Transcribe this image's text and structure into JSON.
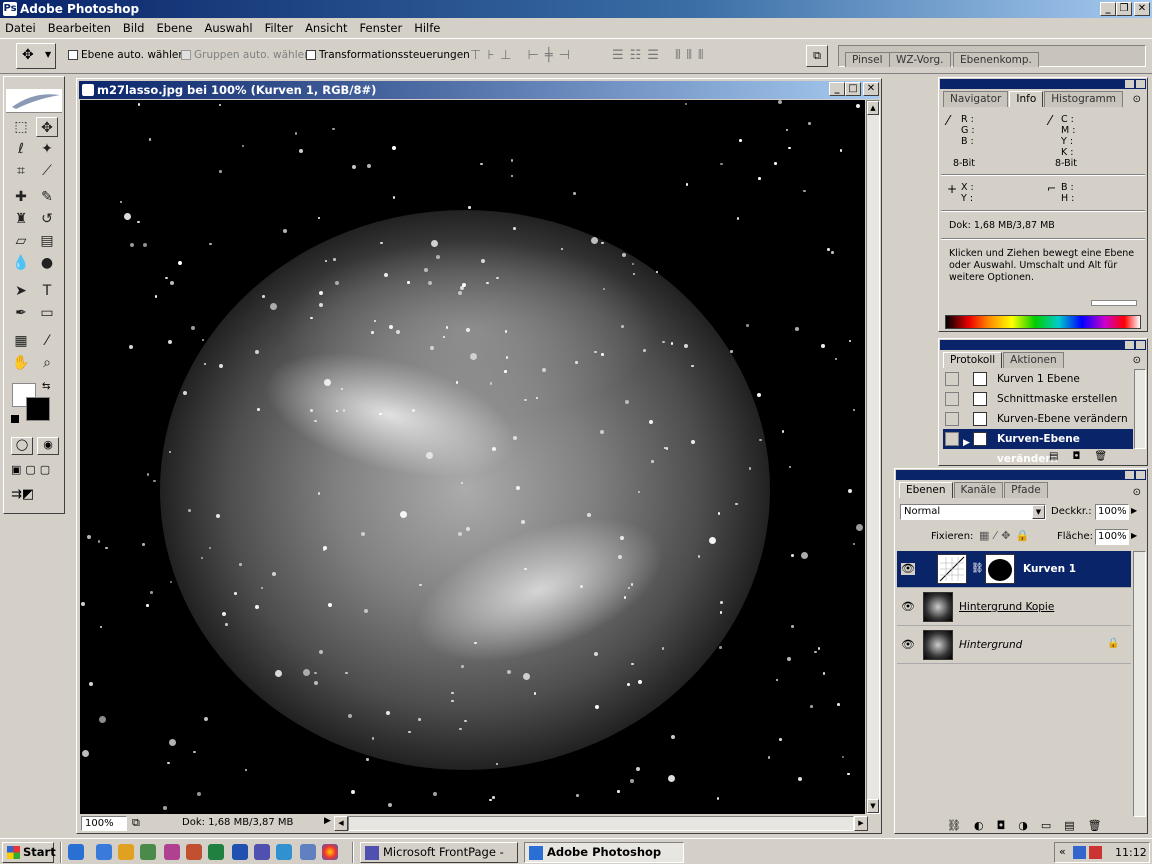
{
  "app": {
    "title": "Adobe Photoshop"
  },
  "menu": [
    "Datei",
    "Bearbeiten",
    "Bild",
    "Ebene",
    "Auswahl",
    "Filter",
    "Ansicht",
    "Fenster",
    "Hilfe"
  ],
  "options": {
    "auto_select_layer": "Ebene auto. wählen",
    "auto_select_groups": "Gruppen auto. wählen",
    "transform_controls": "Transformationssteuerungen",
    "palette_well": [
      "Pinsel",
      "WZ-Vorg.",
      "Ebenenkomp."
    ]
  },
  "document": {
    "title": "m27lasso.jpg bei 100% (Kurven 1, RGB/8#)",
    "zoom": "100%",
    "status": "Dok: 1,68 MB/3,87 MB"
  },
  "info_panel": {
    "tabs": [
      "Navigator",
      "Info",
      "Histogramm"
    ],
    "rgb_labels": [
      "R :",
      "G :",
      "B :"
    ],
    "cmyk_labels": [
      "C :",
      "M :",
      "Y :",
      "K :"
    ],
    "bitdepth_left": "8-Bit",
    "bitdepth_right": "8-Bit",
    "xy_labels": [
      "X :",
      "Y :"
    ],
    "bh_labels": [
      "B :",
      "H :"
    ],
    "doc_size": "Dok: 1,68 MB/3,87 MB",
    "hint": "Klicken und Ziehen bewegt eine Ebene oder Auswahl. Umschalt und Alt für weitere Optionen."
  },
  "history_panel": {
    "tabs": [
      "Protokoll",
      "Aktionen"
    ],
    "items": [
      "Kurven 1 Ebene",
      "Schnittmaske erstellen",
      "Kurven-Ebene verändern",
      "Kurven-Ebene verändern"
    ]
  },
  "layers_panel": {
    "tabs": [
      "Ebenen",
      "Kanäle",
      "Pfade"
    ],
    "blend_mode": "Normal",
    "opacity_label": "Deckkr.:",
    "opacity": "100%",
    "lock_label": "Fixieren:",
    "fill_label": "Fläche:",
    "fill": "100%",
    "layers": [
      "Kurven 1",
      "Hintergrund Kopie",
      "Hintergrund"
    ]
  },
  "taskbar": {
    "start": "Start",
    "tasks": [
      "Microsoft FrontPage - D:...",
      "Adobe Photoshop"
    ],
    "clock": "11:12"
  }
}
